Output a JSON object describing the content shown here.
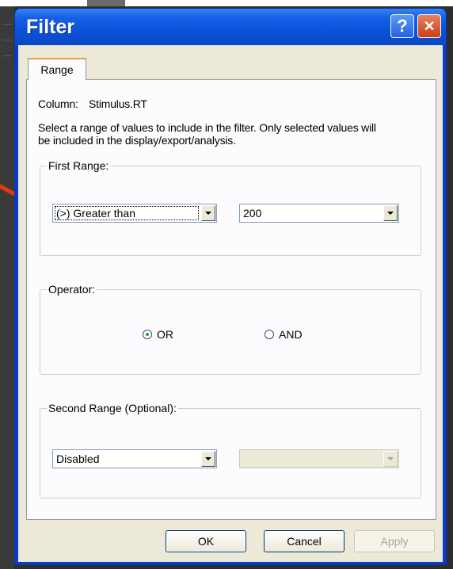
{
  "window": {
    "title": "Filter",
    "help_glyph": "?",
    "close_glyph": "✕"
  },
  "tabs": [
    {
      "label": "Range",
      "selected": true
    }
  ],
  "column_label": "Column:",
  "column_value": "Stimulus.RT",
  "description": "Select a range of values to include in the filter.  Only selected values will be included in the display/export/analysis.",
  "first_range": {
    "legend": "First Range:",
    "comparison": "(>) Greater than",
    "value": "200"
  },
  "operator": {
    "legend": "Operator:",
    "options": [
      {
        "label": "OR",
        "checked": true
      },
      {
        "label": "AND",
        "checked": false
      }
    ]
  },
  "second_range": {
    "legend": "Second Range (Optional):",
    "comparison": "Disabled",
    "value": ""
  },
  "buttons": {
    "ok": "OK",
    "cancel": "Cancel",
    "apply": "Apply"
  },
  "colors": {
    "arrow": "#e03a10",
    "titlebar": "#0a52d8",
    "dialog_face": "#ece9d8"
  },
  "icons": [
    "help-icon",
    "close-icon",
    "red-arrow-annotation"
  ]
}
